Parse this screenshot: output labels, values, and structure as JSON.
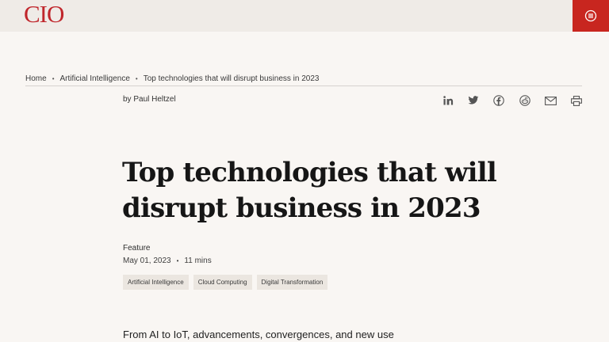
{
  "header": {
    "logo": "CIO",
    "menu_icon": "menu-circle-icon",
    "accent_color": "#c8261f"
  },
  "breadcrumb": {
    "items": [
      "Home",
      "Artificial Intelligence",
      "Top technologies that will disrupt business in 2023"
    ],
    "separator": "•"
  },
  "article": {
    "byline": "by Paul Heltzel",
    "share_icons": [
      "linkedin-icon",
      "twitter-icon",
      "facebook-icon",
      "reddit-icon",
      "email-icon",
      "print-icon"
    ],
    "title": "Top technologies that will disrupt business in 2023",
    "type": "Feature",
    "date": "May 01, 2023",
    "meta_sep": "•",
    "read_time": "11 mins",
    "tags": [
      "Artificial Intelligence",
      "Cloud Computing",
      "Digital Transformation"
    ],
    "intro": "From AI to IoT, advancements, convergences, and new use"
  }
}
